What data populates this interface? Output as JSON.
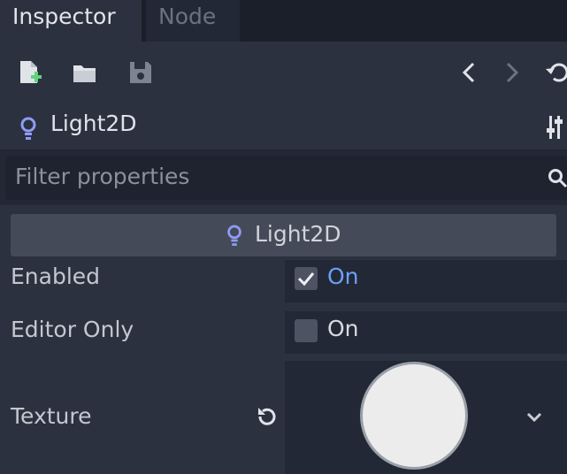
{
  "tabs": [
    {
      "label": "Inspector",
      "active": true
    },
    {
      "label": "Node",
      "active": false
    }
  ],
  "toolbar": {
    "icons": [
      "new-resource-icon",
      "open-folder-icon",
      "save-icon",
      "back-icon",
      "forward-icon",
      "history-icon"
    ]
  },
  "node": {
    "title": "Light2D",
    "icon": "light-bulb-icon",
    "icon_color": "#8f9cf5"
  },
  "filter": {
    "placeholder": "Filter properties"
  },
  "section": {
    "title": "Light2D"
  },
  "properties": [
    {
      "label": "Enabled",
      "value": "On",
      "checked": true
    },
    {
      "label": "Editor Only",
      "value": "On",
      "checked": false
    },
    {
      "label": "Texture"
    }
  ],
  "colors": {
    "accent": "#6d9ff5",
    "panel": "#2c3140",
    "background": "#232836"
  }
}
